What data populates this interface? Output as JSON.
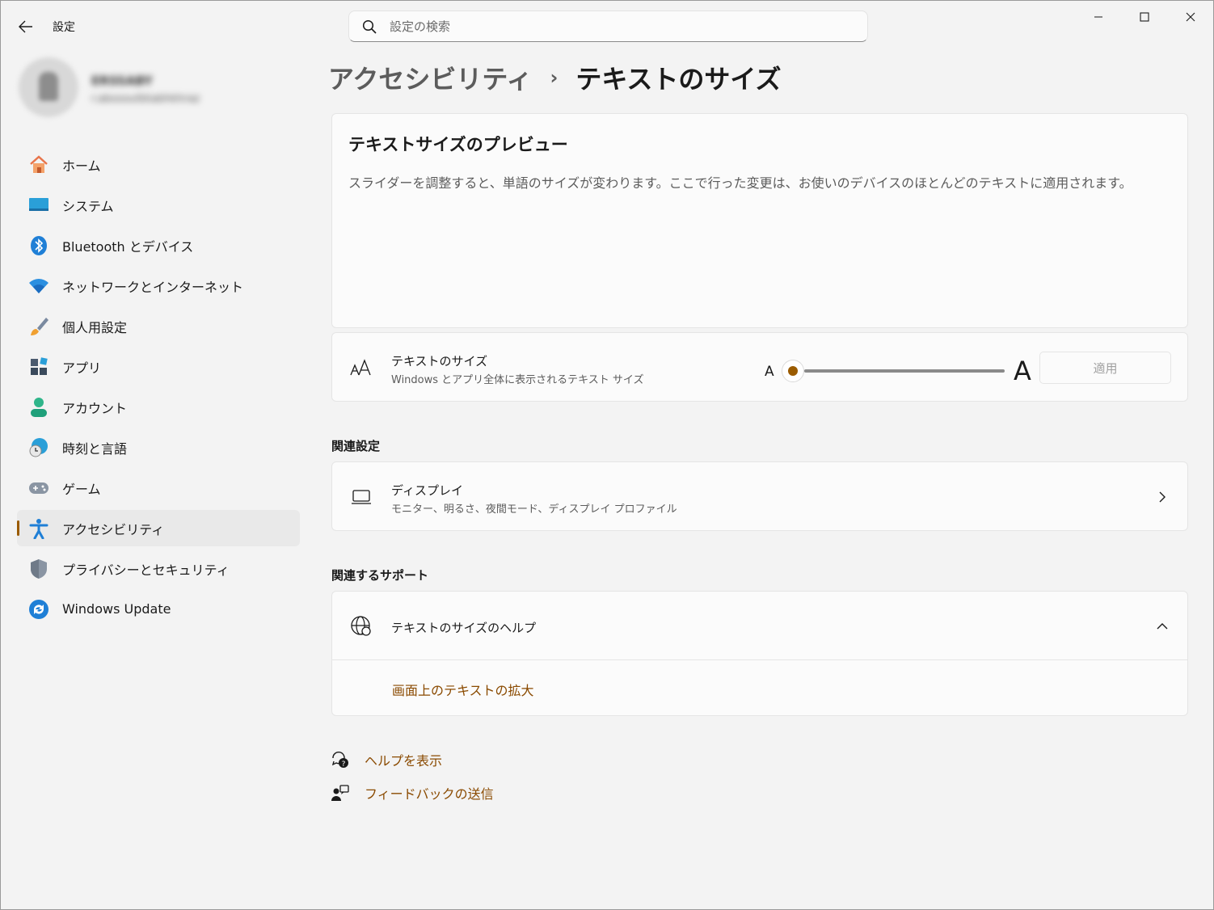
{
  "app": {
    "title": "設定",
    "back_icon": "back-arrow-icon"
  },
  "search": {
    "placeholder": "設定の検索",
    "value": ""
  },
  "window_controls": {
    "minimize": "minimize-icon",
    "maximize": "maximize-icon",
    "close": "close-icon"
  },
  "profile": {
    "name": "ERSSABY",
    "email": "r.abosoutbtabhkhraz"
  },
  "sidebar": {
    "items": [
      {
        "label": "ホーム",
        "icon": "home-icon"
      },
      {
        "label": "システム",
        "icon": "system-icon"
      },
      {
        "label": "Bluetooth とデバイス",
        "icon": "bluetooth-icon"
      },
      {
        "label": "ネットワークとインターネット",
        "icon": "wifi-icon"
      },
      {
        "label": "個人用設定",
        "icon": "brush-icon"
      },
      {
        "label": "アプリ",
        "icon": "apps-icon"
      },
      {
        "label": "アカウント",
        "icon": "account-icon"
      },
      {
        "label": "時刻と言語",
        "icon": "time-language-icon"
      },
      {
        "label": "ゲーム",
        "icon": "gamepad-icon"
      },
      {
        "label": "アクセシビリティ",
        "icon": "accessibility-icon"
      },
      {
        "label": "プライバシーとセキュリティ",
        "icon": "shield-icon"
      },
      {
        "label": "Windows Update",
        "icon": "update-icon"
      }
    ],
    "active_index": 9
  },
  "breadcrumb": {
    "parent": "アクセシビリティ",
    "separator": "›",
    "current": "テキストのサイズ"
  },
  "preview": {
    "title": "テキストサイズのプレビュー",
    "description": "スライダーを調整すると、単語のサイズが変わります。ここで行った変更は、お使いのデバイスのほとんどのテキストに適用されます。"
  },
  "text_size": {
    "title": "テキストのサイズ",
    "subtitle": "Windows とアプリ全体に表示されるテキスト サイズ",
    "icon": "text-size-icon",
    "small_label": "A",
    "large_label": "A",
    "slider_value_percent": 100,
    "slider_fraction": 0,
    "apply_label": "適用",
    "accent": "#9a5b00"
  },
  "related_settings": {
    "heading": "関連設定",
    "display": {
      "title": "ディスプレイ",
      "subtitle": "モニター、明るさ、夜間モード、ディスプレイ プロファイル",
      "icon": "laptop-icon"
    }
  },
  "related_support": {
    "heading": "関連するサポート",
    "help": {
      "title": "テキストのサイズのヘルプ",
      "icon": "globe-help-icon",
      "link": "画面上のテキストの拡大"
    }
  },
  "footer": {
    "get_help": "ヘルプを表示",
    "feedback": "フィードバックの送信"
  },
  "colors": {
    "accent": "#9a5b00",
    "link": "#8a4a00",
    "background": "#f3f3f3",
    "card": "#fbfbfb"
  }
}
